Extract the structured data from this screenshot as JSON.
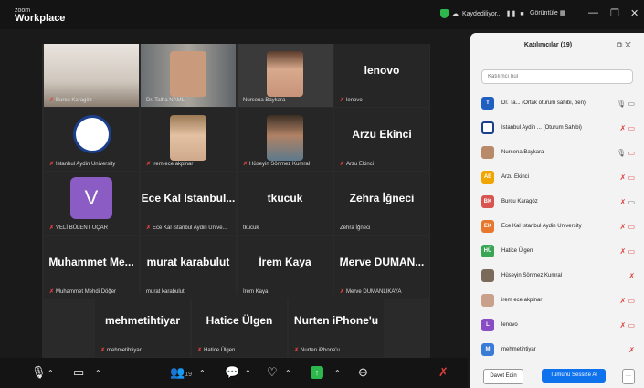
{
  "app": {
    "logo_top": "zoom",
    "logo_bottom": "Workplace",
    "recording": "Kaydediliyor...",
    "view": "Görüntüle"
  },
  "tiles": [
    {
      "big": "",
      "label": "Burcu Karagöz",
      "mic": true
    },
    {
      "big": "",
      "label": "Dr. Talha NAMLI",
      "mic": false
    },
    {
      "big": "",
      "label": "Nursena Baykara",
      "mic": false
    },
    {
      "big": "lenovo",
      "label": "lenovo",
      "mic": true
    },
    {
      "big": "",
      "label": "Istanbul Aydin University",
      "mic": true
    },
    {
      "big": "",
      "label": "irem ece akpinar",
      "mic": true
    },
    {
      "big": "",
      "label": "Hüseyin Sönmez Kumral",
      "mic": true
    },
    {
      "big": "Arzu Ekinci",
      "label": "Arzu Ekinci",
      "mic": true
    },
    {
      "big": "",
      "label": "VELİ BÜLENT UÇAR",
      "mic": true
    },
    {
      "big": "Ece Kal Istanbul...",
      "label": "Ece Kal Istanbul Aydin Unive...",
      "mic": true
    },
    {
      "big": "tkucuk",
      "label": "tkucuk",
      "mic": false
    },
    {
      "big": "Zehra İğneci",
      "label": "Zehra İğneci",
      "mic": false
    },
    {
      "big": "Muhammet Me...",
      "label": "Muhammet Mehdi Döğer",
      "mic": true
    },
    {
      "big": "murat karabulut",
      "label": "murat karabulut",
      "mic": false
    },
    {
      "big": "İrem Kaya",
      "label": "İrem Kaya",
      "mic": false
    },
    {
      "big": "Merve DUMAN...",
      "label": "Merve DUMANLIKAYA",
      "mic": true
    },
    {
      "big": "mehmetihtiyar",
      "label": "mehmetihtiyar",
      "mic": true
    },
    {
      "big": "Hatice Ülgen",
      "label": "Hatice Ülgen",
      "mic": true
    },
    {
      "big": "Nurten iPhone'u",
      "label": "Nurten iPhone'u",
      "mic": true
    }
  ],
  "toolbar": {
    "participants_count": "19"
  },
  "panel": {
    "title": "Katılımcılar (19)",
    "search_placeholder": "Katılımcı bul",
    "rows": [
      {
        "initials": "T",
        "color": "#1f5fbf",
        "name": "Dr. Ta... (Ortak oturum sahibi, ben)"
      },
      {
        "initials": "",
        "color": "#1c3f8c",
        "name": "Istanbul Aydin ... (Oturum Sahibi)"
      },
      {
        "initials": "",
        "color": "#b88a6a",
        "name": "Nursena Baykara"
      },
      {
        "initials": "AE",
        "color": "#f0a500",
        "name": "Arzu Ekinci"
      },
      {
        "initials": "BK",
        "color": "#d9534f",
        "name": "Burcu Karagöz"
      },
      {
        "initials": "EK",
        "color": "#e8772e",
        "name": "Ece Kal Istanbul Aydin University"
      },
      {
        "initials": "HÜ",
        "color": "#3aa655",
        "name": "Hatice Ülgen"
      },
      {
        "initials": "",
        "color": "#7a6a5a",
        "name": "Hüseyin Sönmez Kumral"
      },
      {
        "initials": "",
        "color": "#c9a08a",
        "name": "irem ece akpinar"
      },
      {
        "initials": "L",
        "color": "#8a4cc4",
        "name": "lenovo"
      },
      {
        "initials": "M",
        "color": "#3a7bd5",
        "name": "mehmetihtiyar"
      }
    ],
    "invite_label": "Davet Edin",
    "mute_all_label": "Tümünü Sessize Al",
    "more_label": "···"
  }
}
